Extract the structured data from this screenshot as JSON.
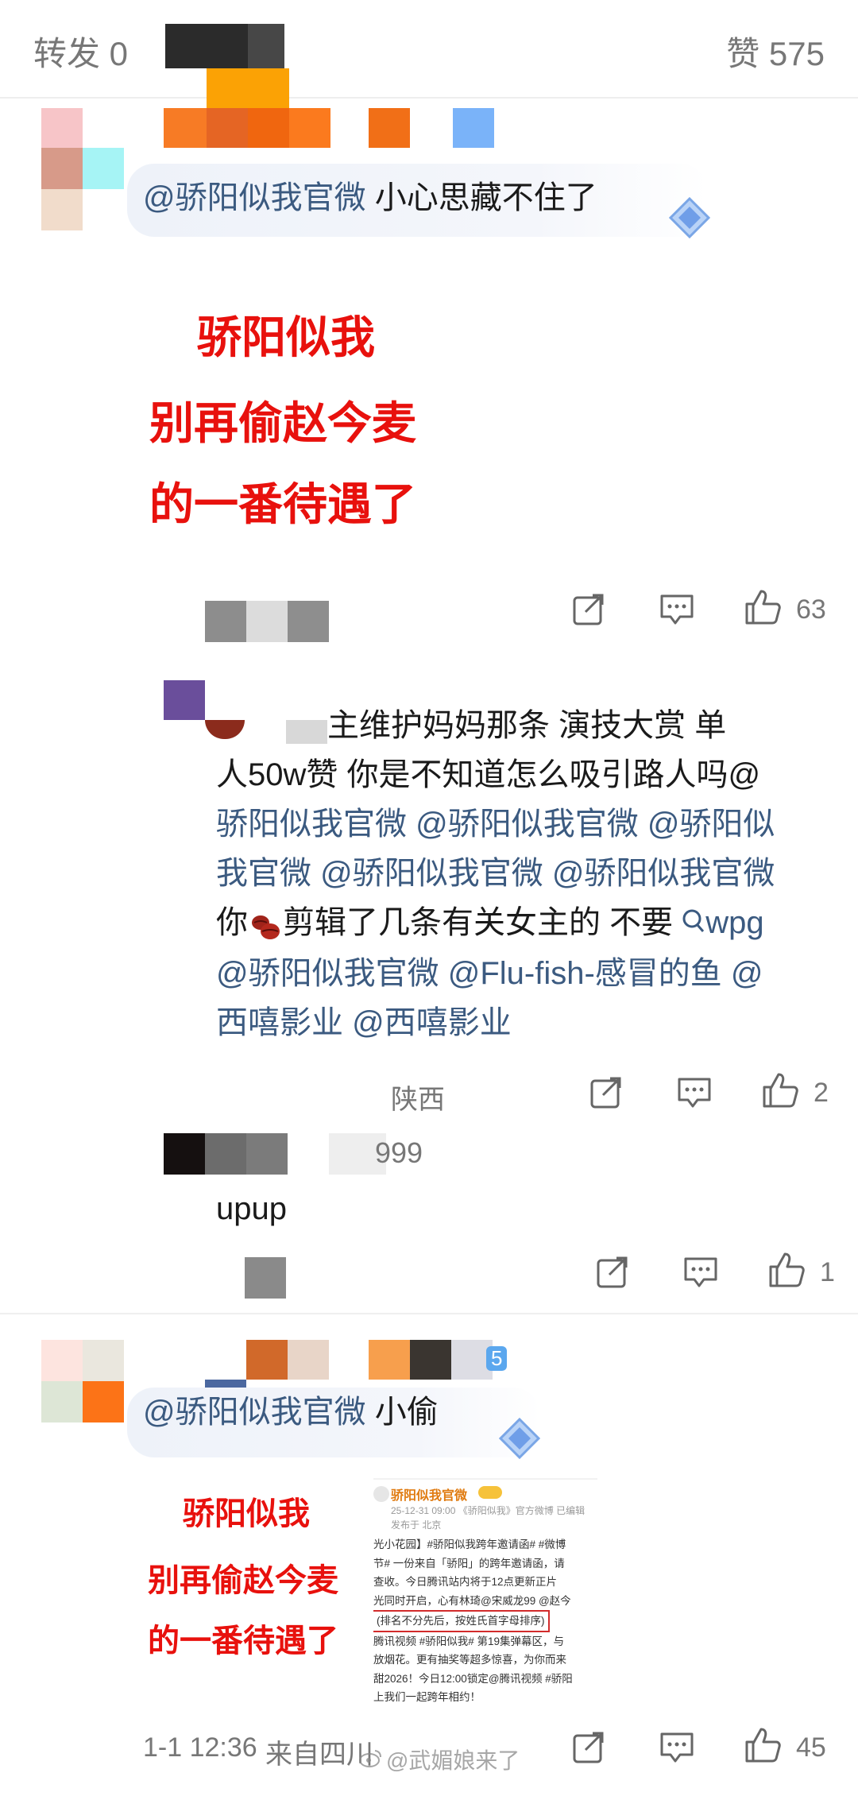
{
  "header": {
    "repost_label": "转发 0",
    "like_label": "赞 575"
  },
  "comment1": {
    "mention": "@骄阳似我官微",
    "text": " 小心思藏不住了",
    "image_lines": [
      "骄阳似我",
      "别再偷赵今麦",
      "的一番待遇了"
    ],
    "like_count": "63"
  },
  "reply1": {
    "line1": "主维护妈妈那条 演技大赏 单",
    "line2": "人50w赞 你是不知道怎么吸引路人吗@",
    "line3": "骄阳似我官微 @骄阳似我官微 @骄阳似",
    "line4": "我官微 @骄阳似我官微 @骄阳似我官微",
    "line5_pre": "你",
    "line5_post": "剪辑了几条有关女主的 不要",
    "search_term": "wpg",
    "line6": "@骄阳似我官微 @Flu-fish-感冒的鱼 @",
    "line7": "西嘻影业 @西嘻影业",
    "location": "陕西",
    "like_count": "2"
  },
  "reply2": {
    "name_suffix": "999",
    "text": "upup",
    "like_count": "1"
  },
  "comment2": {
    "mention": "@骄阳似我官微",
    "text": " 小偷",
    "badge": "5",
    "image_lines": [
      "骄阳似我",
      "别再偷赵今麦",
      "的一番待遇了"
    ],
    "screenshot": {
      "account": "骄阳似我官微",
      "meta": "25-12-31 09:00 《骄阳似我》官方微博 已编辑",
      "publish": "发布于 北京",
      "lines": [
        "光小花园】#骄阳似我跨年邀请函# #微博",
        "节# 一份来自「骄阳」的跨年邀请函，请",
        "查收。今日腾讯站内将于12点更新正片",
        "光同时开启，心有林琦@宋威龙99 @赵今",
        "(排名不分先后，按姓氏首字母排序)",
        "腾讯视频 #骄阳似我# 第19集弹幕区，与",
        "放烟花。更有抽奖等超多惊喜，为你而来",
        "甜2026！今日12:00锁定@腾讯视频 #骄阳",
        "上我们一起跨年相约！"
      ]
    },
    "timestamp": "1-1 12:36",
    "location": "来自四川",
    "like_count": "45",
    "watermark": "@武媚娘来了"
  },
  "icons": {
    "repost": "repost-icon",
    "comment": "comment-icon",
    "like": "thumbs-up-icon",
    "search": "search-icon",
    "bean": "coffee-bean-emoji",
    "diamond": "diamond-badge-icon"
  },
  "colors": {
    "accent_red": "#e8110d",
    "mention_blue": "#3b5a80",
    "meta_gray": "#777777"
  }
}
